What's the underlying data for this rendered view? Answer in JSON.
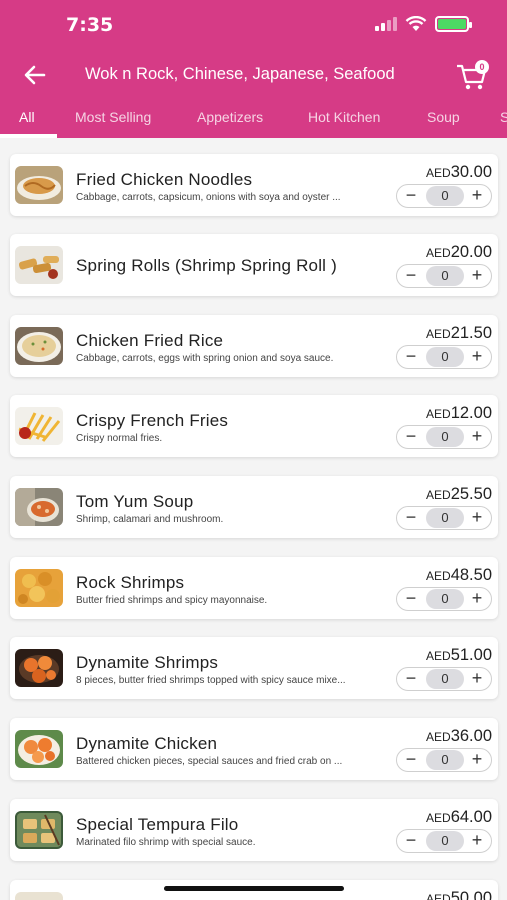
{
  "status_bar": {
    "time": "7:35"
  },
  "header": {
    "title": "Wok n Rock, Chinese, Japanese, Seafood",
    "cart_count": "0"
  },
  "tabs": [
    "All",
    "Most Selling",
    "Appetizers",
    "Hot Kitchen",
    "Soup",
    "S"
  ],
  "colors": {
    "brand": "#d63b86",
    "battery": "#4cd964"
  },
  "items": [
    {
      "name": "Fried Chicken Noodles",
      "desc": "Cabbage, carrots, capsicum, onions with soya and oyster ...",
      "currency": "AED",
      "price": "30.00",
      "qty": "0"
    },
    {
      "name": "Spring Rolls (Shrimp Spring Roll )",
      "desc": "",
      "currency": "AED",
      "price": "20.00",
      "qty": "0"
    },
    {
      "name": "Chicken Fried Rice",
      "desc": "Cabbage, carrots, eggs with spring onion and soya sauce.",
      "currency": "AED",
      "price": "21.50",
      "qty": "0"
    },
    {
      "name": "Crispy French Fries",
      "desc": "Crispy normal fries.",
      "currency": "AED",
      "price": "12.00",
      "qty": "0"
    },
    {
      "name": "Tom Yum Soup",
      "desc": "Shrimp, calamari and mushroom.",
      "currency": "AED",
      "price": "25.50",
      "qty": "0"
    },
    {
      "name": "Rock Shrimps",
      "desc": "Butter fried shrimps and spicy mayonnaise.",
      "currency": "AED",
      "price": "48.50",
      "qty": "0"
    },
    {
      "name": "Dynamite Shrimps",
      "desc": "8 pieces, butter fried shrimps topped with spicy sauce mixe...",
      "currency": "AED",
      "price": "51.00",
      "qty": "0"
    },
    {
      "name": "Dynamite Chicken",
      "desc": "Battered chicken pieces, special sauces and fried crab on ...",
      "currency": "AED",
      "price": "36.00",
      "qty": "0"
    },
    {
      "name": "Special Tempura Filo",
      "desc": "Marinated filo shrimp with special sauce.",
      "currency": "AED",
      "price": "64.00",
      "qty": "0"
    },
    {
      "name": "",
      "desc": "",
      "currency": "AED",
      "price": "50.00",
      "qty": "0"
    }
  ],
  "stepper": {
    "minus": "−",
    "plus": "+"
  }
}
